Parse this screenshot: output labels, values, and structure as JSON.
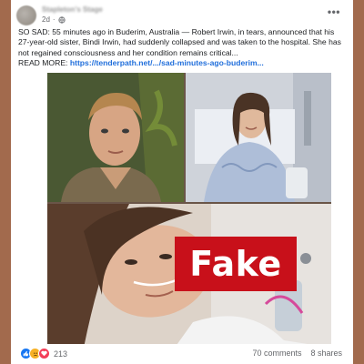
{
  "post": {
    "author": "Stapleton's Stage",
    "time": "2d",
    "privacy_icon": "globe-icon",
    "more_icon": "more-options-icon",
    "body": "SO SAD: 55 minutes ago in Buderim, Australia — Robert Irwin, in tears, announced that his 27-year-old sister, Bindi Irwin, had suddenly collapsed and was taken to the hospital. She has not regained consciousness and her condition remains critical...",
    "read_more_label": "READ MORE:",
    "read_more_link": "https://tenderpath.net/.../sad-minutes-ago-buderim..."
  },
  "image": {
    "overlay_label": "Fake"
  },
  "footer": {
    "reaction_count": "213",
    "reaction_icons": [
      "like-icon",
      "sad-icon",
      "love-icon"
    ],
    "comments": "70 comments",
    "shares": "8 shares"
  },
  "colors": {
    "background": "#a26a4d",
    "fake_label": "#c8101a",
    "link": "#216fdb"
  }
}
